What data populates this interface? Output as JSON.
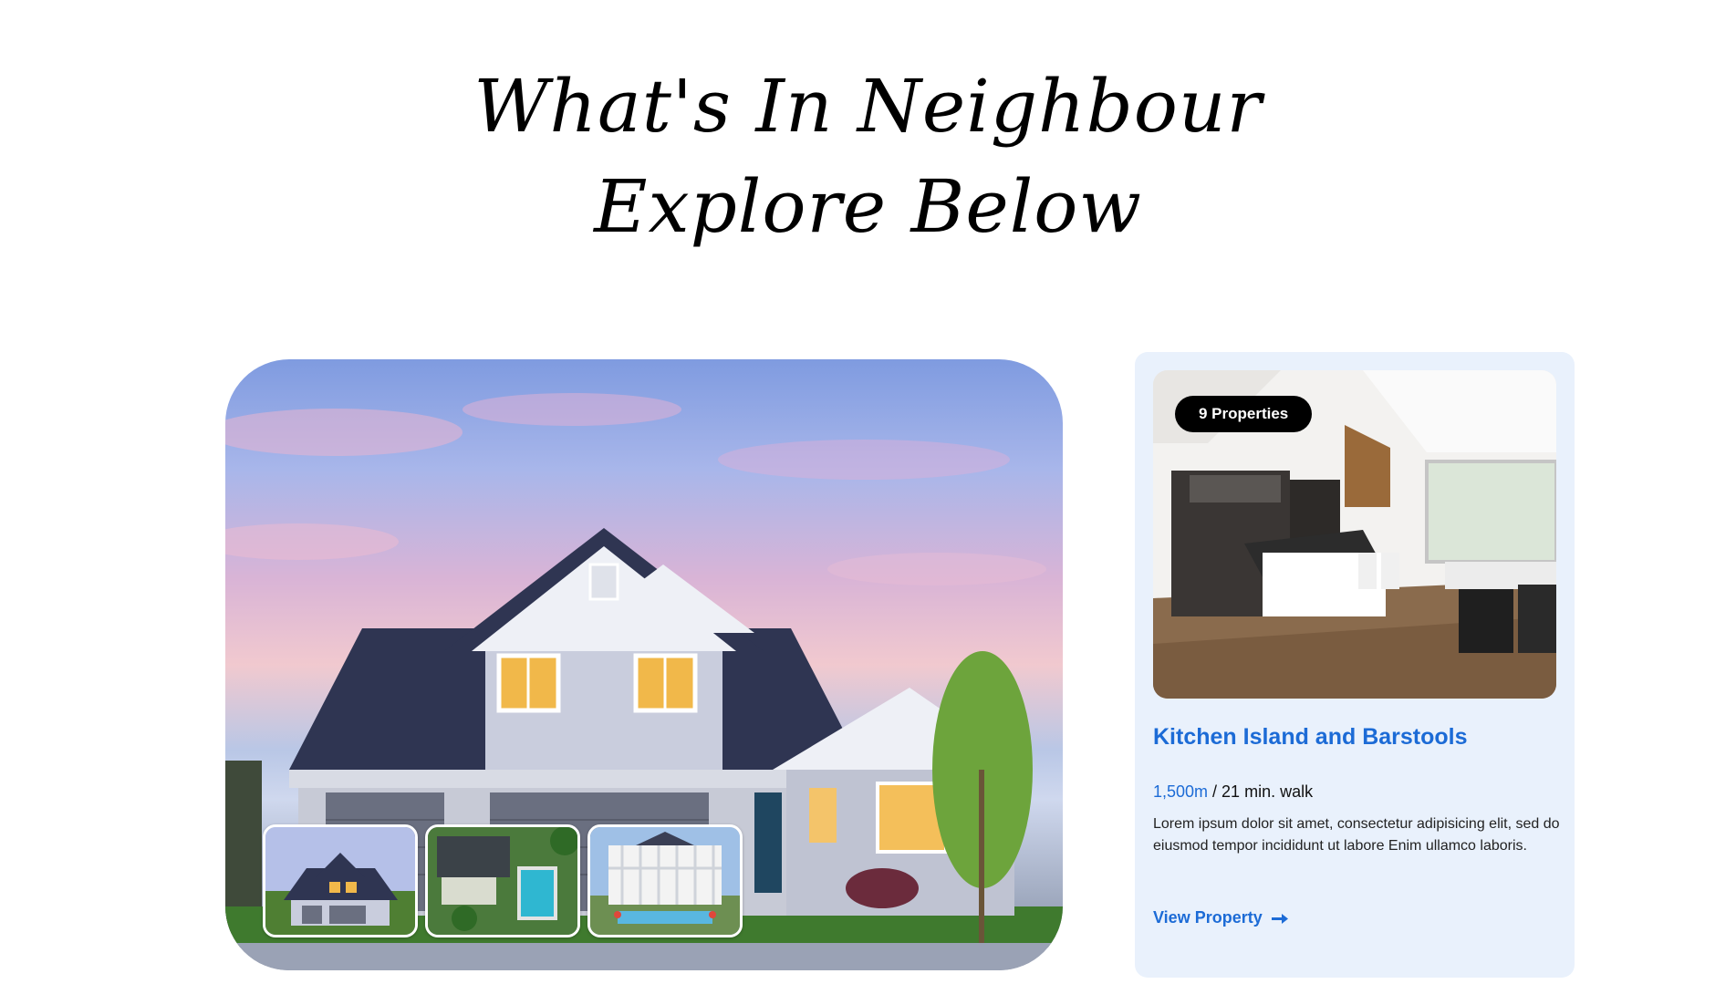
{
  "section": {
    "heading_line1": "What's In Neighbour",
    "heading_line2": "Explore Below"
  },
  "gallery": {
    "main_image": "house-exterior-dusk",
    "thumbnails": [
      "house-exterior-dusk",
      "aerial-pool-villa",
      "white-colonial-mansion-pool"
    ]
  },
  "card": {
    "badge": "9 Properties",
    "title": "Kitchen Island and Barstools",
    "distance_value": "1,500m",
    "distance_suffix": " / 21 min. walk",
    "description": "Lorem ipsum dolor sit amet, consectetur adipisicing elit, sed do eiusmod tempor incididunt ut labore Enim ullamco laboris.",
    "link_label": "View Property",
    "link_icon": "arrow-right-icon",
    "accent_color": "#1c6bd6",
    "card_bg": "#e9f1fc"
  }
}
